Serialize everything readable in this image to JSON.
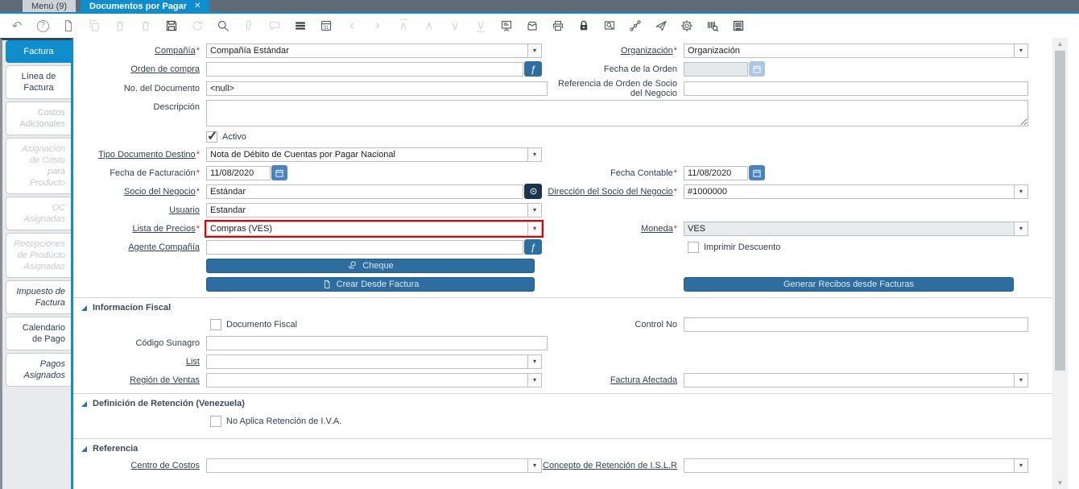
{
  "tab_bar": {
    "menu_tab": "Menú (9)",
    "active_tab": "Documentos por Pagar"
  },
  "toolbar_icons": [
    {
      "name": "undo-icon",
      "state": "on"
    },
    {
      "name": "help-icon",
      "state": "on"
    },
    {
      "name": "new-record-icon",
      "state": "on"
    },
    {
      "name": "copy-icon",
      "state": "off"
    },
    {
      "name": "delete-icon",
      "state": "off"
    },
    {
      "name": "delete-selection-icon",
      "state": "off"
    },
    {
      "name": "save-icon",
      "state": "darkest"
    },
    {
      "name": "refresh-icon",
      "state": "off"
    },
    {
      "name": "search-icon",
      "state": "dark"
    },
    {
      "name": "attachment-icon",
      "state": "off"
    },
    {
      "name": "chat-icon",
      "state": "off"
    },
    {
      "name": "grid-view-icon",
      "state": "darkest"
    },
    {
      "name": "calendar-icon",
      "state": "dark"
    },
    {
      "name": "nav-prev-icon",
      "state": "off"
    },
    {
      "name": "nav-next-icon",
      "state": "off"
    },
    {
      "name": "nav-first-icon",
      "state": "off"
    },
    {
      "name": "nav-up-icon",
      "state": "off"
    },
    {
      "name": "nav-down-icon",
      "state": "off"
    },
    {
      "name": "nav-last-icon",
      "state": "off"
    },
    {
      "name": "detail-panel-icon",
      "state": "dark"
    },
    {
      "name": "archive-icon",
      "state": "dark"
    },
    {
      "name": "print-icon",
      "state": "dark"
    },
    {
      "name": "lock-icon",
      "state": "darkest"
    },
    {
      "name": "print-preview-icon",
      "state": "dark"
    },
    {
      "name": "workflow-icon",
      "state": "dark"
    },
    {
      "name": "send-icon",
      "state": "dark"
    },
    {
      "name": "settings-icon",
      "state": "dark"
    },
    {
      "name": "report-icon",
      "state": "darkest"
    },
    {
      "name": "summary-icon",
      "state": "darkest"
    }
  ],
  "sidebar": {
    "tabs": [
      {
        "label": "Factura",
        "state": "active"
      },
      {
        "label": "Línea de Factura",
        "state": "normal"
      },
      {
        "label": "Costos Adicionales",
        "state": "disabled"
      },
      {
        "label": "Asignación de Costo para Producto",
        "state": "disabled-italic"
      },
      {
        "label": "OC Asignadas",
        "state": "disabled-italic"
      },
      {
        "label": "Recepciones de Producto Asignadas",
        "state": "disabled-italic"
      },
      {
        "label": "Impuesto de Factura",
        "state": "italic"
      },
      {
        "label": "Calendario de Pago",
        "state": "normal"
      },
      {
        "label": "Pagos Asignados",
        "state": "italic"
      }
    ]
  },
  "form": {
    "compania": {
      "label": "Compañía",
      "value": "Compañía Estándar",
      "required": true
    },
    "organizacion": {
      "label": "Organización",
      "value": "Organización",
      "required": true
    },
    "orden_compra": {
      "label": "Orden de compra",
      "value": ""
    },
    "fecha_orden": {
      "label": "Fecha de la Orden",
      "value": "",
      "disabled": true
    },
    "no_documento": {
      "label": "No. del Documento",
      "value": "<null>"
    },
    "referencia_orden": {
      "label": "Referencia de Orden de Socio del Negocio",
      "value": ""
    },
    "descripcion": {
      "label": "Descripción",
      "value": ""
    },
    "activo": {
      "label": "Activo",
      "checked": true
    },
    "tipo_doc": {
      "label": "Tipo Documento Destino",
      "value": "Nota de Débito de Cuentas por Pagar Nacional",
      "required": true
    },
    "fecha_fact": {
      "label": "Fecha de Facturación",
      "value": "11/08/2020",
      "required": true
    },
    "fecha_cont": {
      "label": "Fecha Contable",
      "value": "11/08/2020",
      "required": true
    },
    "socio": {
      "label": "Socio del Negocio",
      "value": "Estándar",
      "required": true
    },
    "direccion": {
      "label": "Dirección del Socio del Negocio",
      "value": "#1000000",
      "required": true
    },
    "usuario": {
      "label": "Usuario",
      "value": "Estandar"
    },
    "lista_precios": {
      "label": "Lista de Precios",
      "value": "Compras (VES)",
      "required": true,
      "highlight": "#e10000"
    },
    "moneda": {
      "label": "Moneda",
      "value": "VES",
      "required": true,
      "readonly": true
    },
    "agente": {
      "label": "Agente Compañía",
      "value": ""
    },
    "imprimir_descuento": {
      "label": "Imprimir Descuento",
      "checked": false
    },
    "btn_cheque": "Cheque",
    "btn_crear": "Crear Desde Factura",
    "btn_generar": "Generar Recibos desde Facturas"
  },
  "sections": {
    "fiscal": {
      "title": "Informacion Fiscal",
      "documento_fiscal": {
        "label": "Documento Fiscal",
        "checked": false
      },
      "control_no": {
        "label": "Control No",
        "value": ""
      },
      "codigo_sunagro": {
        "label": "Código Sunagro",
        "value": ""
      },
      "list": {
        "label": "List",
        "value": ""
      },
      "region_ventas": {
        "label": "Región de Ventas",
        "value": ""
      },
      "factura_afectada": {
        "label": "Factura Afectada",
        "value": ""
      }
    },
    "retencion": {
      "title": "Definición de Retención (Venezuela)",
      "no_aplica_iva": {
        "label": "No Aplica Retención de I.V.A.",
        "checked": false
      }
    },
    "referencia": {
      "title": "Referencia",
      "centro_costos": {
        "label": "Centro de Costos",
        "value": ""
      },
      "concepto_islr": {
        "label": "Concepto de Retención de I.S.L.R",
        "value": ""
      }
    }
  },
  "colors": {
    "accent_blue": "#0f8dcd",
    "button_blue": "#2d6da0",
    "navy_button": "#18344f",
    "highlight_red": "#e10000",
    "tabbar_bg": "#5f6c78"
  }
}
